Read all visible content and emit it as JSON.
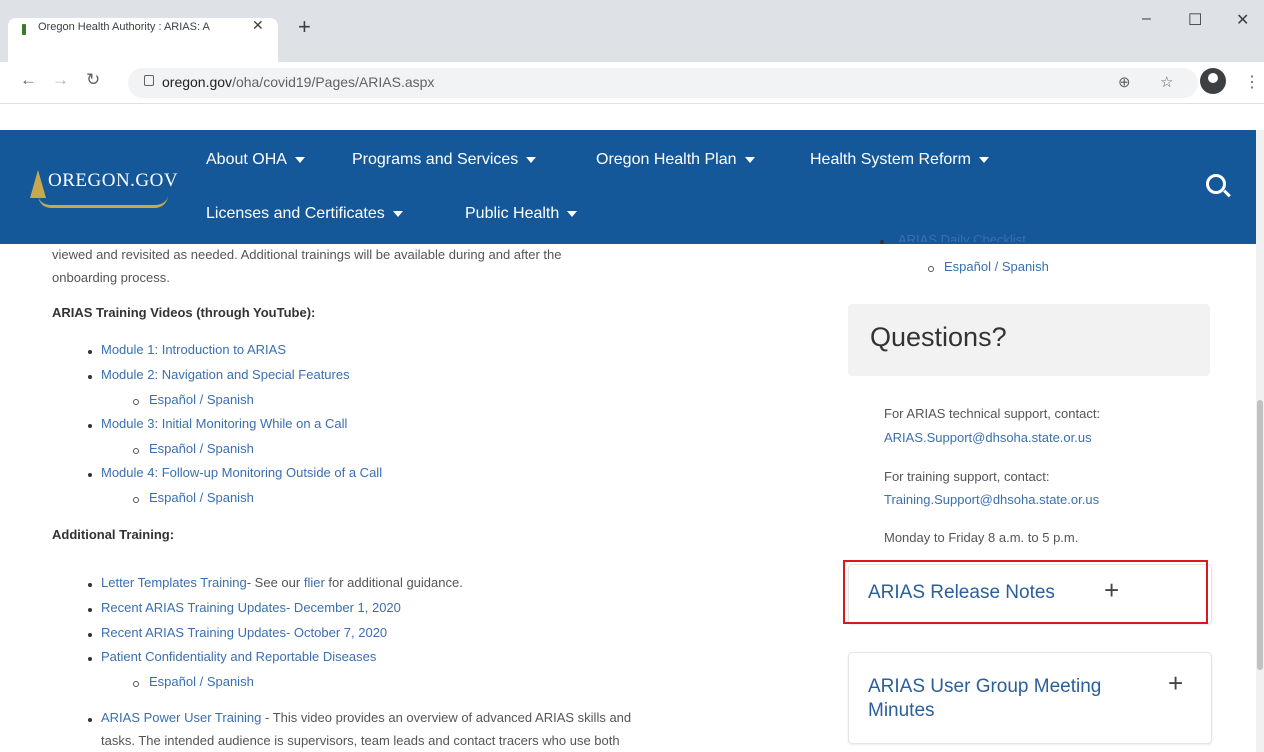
{
  "browser": {
    "tab_title": "Oregon Health Authority : ARIAS: A",
    "tab_close": "✕",
    "new_tab": "+",
    "url_domain": "oregon.gov",
    "url_path": "/oha/covid19/Pages/ARIAS.aspx",
    "window_controls": [
      "–",
      "☐",
      "✕"
    ]
  },
  "header": {
    "logo_text": "OREGON.GOV",
    "nav_row1": [
      "About OHA",
      "Programs and Services",
      "Oregon Health Plan",
      "Health System Reform"
    ],
    "nav_row2": [
      "Licenses and Certificates",
      "Public Health"
    ]
  },
  "main": {
    "intro_line1": "viewed and revisited as needed. Additional trainings will be available during and after the",
    "intro_line2": "onboarding process.",
    "videos_heading": "ARIAS Training Videos (through YouTube):",
    "modules": [
      {
        "label": "Module 1: Introduction to ARIAS"
      },
      {
        "label": "Module 2: Navigation and Special Features",
        "sub": "Español / Spanish"
      },
      {
        "label": "Module 3: Initial Monitoring While on a Call",
        "sub": "Español / Spanish"
      },
      {
        "label": "Module 4: Follow-up Monitoring Outside of a Call",
        "sub": "Español / Spanish"
      }
    ],
    "additional_heading": "Additional Training:",
    "letter_link": "Letter Templates Training",
    "letter_text_a": "- See our ",
    "letter_flier": "flier",
    "letter_text_b": " for additional guidance.",
    "updates_dec": "Recent ARIAS Training Updates- December 1, 2020",
    "updates_oct": "Recent ARIAS Training Updates- October 7, 2020",
    "confidentiality": "Patient Confidentiality and Reportable Diseases",
    "confidentiality_sub": "Español / Spanish",
    "power_link": "ARIAS Power User Training",
    "power_text": " - This video provides an overview of advanced ARIAS skills and",
    "power_text2": "tasks. The intended audience is supervisors, team leads and contact tracers who use both"
  },
  "sidebar": {
    "daily_checklist": "ARIAS Daily Checklist",
    "daily_sub": "Español / Spanish",
    "questions_title": "Questions?",
    "tech_support_text": "For ARIAS technical support, contact:",
    "tech_support_email": "ARIAS.Support@dhsoha.state.or.us",
    "training_text": "For training support, contact:",
    "training_email": "Training.Support@dhsoha.state.or.us",
    "hours": "Monday to Friday 8 a.m. to 5 p.m.",
    "release_notes": "ARIAS Release Notes",
    "user_group": "ARIAS User Group Meeting Minutes",
    "plus": "+"
  },
  "colors": {
    "header_bg": "#14589a",
    "link": "#3a6fb0",
    "highlight": "#d7191f"
  }
}
